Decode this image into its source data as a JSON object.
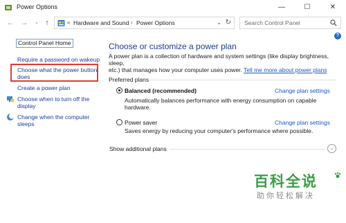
{
  "window": {
    "title": "Power Options",
    "controls": {
      "minimize": "—",
      "maximize": "☐",
      "close": "✕"
    }
  },
  "nav": {
    "back_icon": "←",
    "forward_icon": "→",
    "up_icon": "↑",
    "breadcrumb_sep": "«",
    "crumbs": [
      "Hardware and Sound",
      "Power Options"
    ],
    "crumb_arrow": "›",
    "dropdown_icon": "⌄",
    "refresh_icon": "↻",
    "search_placeholder": "Search Control Panel"
  },
  "help_label": "?",
  "sidebar": {
    "home": "Control Panel Home",
    "links": [
      {
        "line1": "Require a password on wakeup",
        "line2": ""
      },
      {
        "line1": "Choose what the power button",
        "line2": "does"
      },
      {
        "line1": "Create a power plan",
        "line2": ""
      },
      {
        "line1": "Choose when to turn off the",
        "line2": "display"
      },
      {
        "line1": "Change when the computer",
        "line2": "sleeps"
      }
    ]
  },
  "main": {
    "title": "Choose or customize a power plan",
    "desc_line1": "A power plan is a collection of hardware and system settings (like display brightness, sleep,",
    "desc_line2": "etc.) that manages how your computer uses power.",
    "desc_link": "Tell me more about power plans",
    "section": "Preferred plans",
    "plans": [
      {
        "name": "Balanced (recommended)",
        "selected": true,
        "desc_line1": "Automatically balances performance with energy consumption on capable",
        "desc_line2": "hardware.",
        "change": "Change plan settings"
      },
      {
        "name": "Power saver",
        "selected": false,
        "desc_line1": "Saves energy by reducing your computer's performance where possible.",
        "desc_line2": "",
        "change": "Change plan settings"
      }
    ],
    "show_more": "Show additional plans",
    "show_more_icon": "⌄"
  },
  "watermark": {
    "title": "百科全说",
    "subtitle": "助你轻松解决"
  },
  "colors": {
    "link": "#1a57c4",
    "title": "#1e3a8f",
    "highlight": "#e23a30",
    "watermark": "#3c9c48"
  }
}
